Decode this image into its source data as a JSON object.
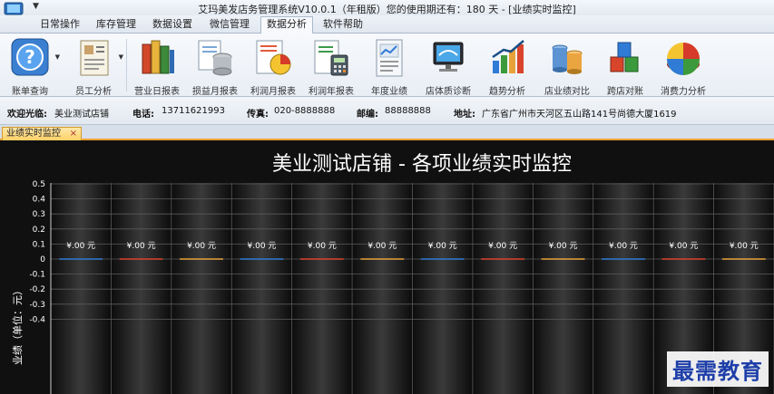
{
  "window": {
    "title": "艾玛美发店务管理系统V10.0.1（年租版）您的使用期还有：180 天 - [业绩实时监控]"
  },
  "ribbon_tabs": [
    "日常操作",
    "库存管理",
    "数据设置",
    "微信管理",
    "数据分析",
    "软件帮助"
  ],
  "active_tab": "数据分析",
  "ribbon_buttons": [
    {
      "label": "账单查询",
      "icon": "help-icon"
    },
    {
      "label": "员工分析",
      "icon": "employee-icon"
    },
    {
      "label": "营业日报表",
      "icon": "books-icon"
    },
    {
      "label": "损益月报表",
      "icon": "database-icon"
    },
    {
      "label": "利润月报表",
      "icon": "pie-report-icon"
    },
    {
      "label": "利润年报表",
      "icon": "calculator-icon"
    },
    {
      "label": "年度业绩",
      "icon": "document-chart-icon"
    },
    {
      "label": "店体质诊断",
      "icon": "monitor-icon"
    },
    {
      "label": "趋势分析",
      "icon": "trend-chart-icon"
    },
    {
      "label": "店业绩对比",
      "icon": "compare-icon"
    },
    {
      "label": "跨店对账",
      "icon": "cubes-icon"
    },
    {
      "label": "消费力分析",
      "icon": "pie-chart-icon"
    }
  ],
  "info_bar": {
    "welcome_label": "欢迎光临:",
    "welcome_value": "美业测试店铺",
    "phone_label": "电话:",
    "phone_value": "13711621993",
    "fax_label": "传真:",
    "fax_value": "020-8888888",
    "zip_label": "邮编:",
    "zip_value": "88888888",
    "address_label": "地址:",
    "address_value": "广东省广州市天河区五山路141号尚德大厦1619"
  },
  "doc_tab": {
    "label": "业绩实时监控",
    "close": "×"
  },
  "chart_data": {
    "type": "bar",
    "title": "美业测试店铺 - 各项业绩实时监控",
    "ylabel": "业绩（单位：元）",
    "ylim": [
      -0.5,
      0.5
    ],
    "yticks": [
      "0.5",
      "0.4",
      "0.3",
      "0.2",
      "0.1",
      "0",
      "-0.1",
      "-0.2",
      "-0.3",
      "-0.4"
    ],
    "grid": true,
    "categories": [
      "",
      "",
      "",
      "",
      "",
      "",
      "",
      "",
      "",
      "",
      "",
      ""
    ],
    "values": [
      0,
      0,
      0,
      0,
      0,
      0,
      0,
      0,
      0,
      0,
      0,
      0
    ],
    "data_labels": [
      "¥.00 元",
      "¥.00 元",
      "¥.00 元",
      "¥.00 元",
      "¥.00 元",
      "¥.00 元",
      "¥.00 元",
      "¥.00 元",
      "¥.00 元",
      "¥.00 元",
      "¥.00 元",
      "¥.00 元"
    ],
    "bar_colors": [
      "#2f7bd6",
      "#d9452b",
      "#e8a23a",
      "#2f7bd6",
      "#d9452b",
      "#e8a23a",
      "#2f7bd6",
      "#d9452b",
      "#e8a23a",
      "#2f7bd6",
      "#d9452b",
      "#e8a23a"
    ]
  },
  "watermark": "最需教育"
}
